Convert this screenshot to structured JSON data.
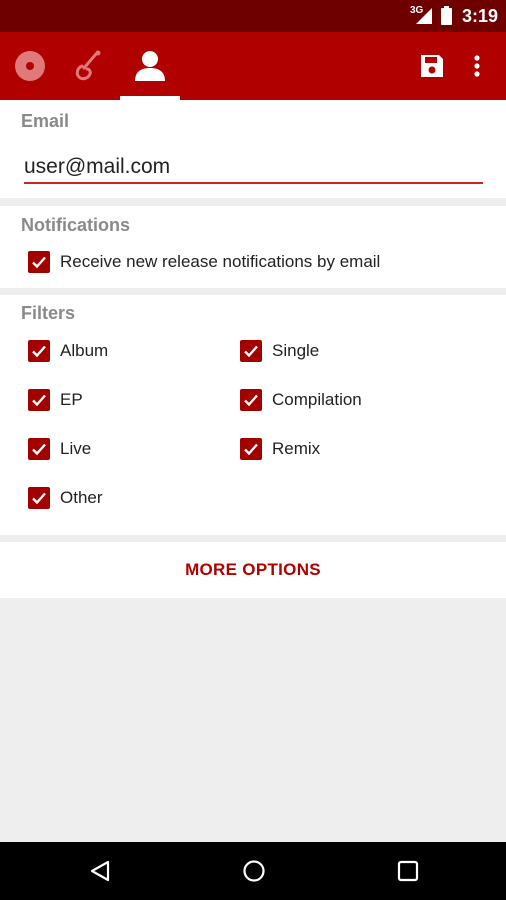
{
  "status_bar": {
    "network_label": "3G",
    "time": "3:19",
    "icons": [
      "signal-icon",
      "battery-icon"
    ]
  },
  "app_bar": {
    "tabs": [
      {
        "icon": "disc-icon",
        "selected": false
      },
      {
        "icon": "guitar-icon",
        "selected": false
      },
      {
        "icon": "person-icon",
        "selected": true
      }
    ],
    "actions": [
      "save-icon",
      "overflow-menu-icon"
    ],
    "colors": {
      "primary": "#b00000",
      "primary_dark": "#6e0000",
      "accent": "#c62828"
    }
  },
  "email": {
    "label": "Email",
    "value": "user@mail.com"
  },
  "notifications": {
    "label": "Notifications",
    "option": {
      "label": "Receive new release notifications by email",
      "checked": true
    }
  },
  "filters": {
    "label": "Filters",
    "items": [
      {
        "label": "Album",
        "checked": true
      },
      {
        "label": "Single",
        "checked": true
      },
      {
        "label": "EP",
        "checked": true
      },
      {
        "label": "Compilation",
        "checked": true
      },
      {
        "label": "Live",
        "checked": true
      },
      {
        "label": "Remix",
        "checked": true
      },
      {
        "label": "Other",
        "checked": true
      }
    ]
  },
  "more_options_label": "MORE OPTIONS",
  "nav_bar": {
    "buttons": [
      "back-icon",
      "home-icon",
      "recents-icon"
    ]
  }
}
